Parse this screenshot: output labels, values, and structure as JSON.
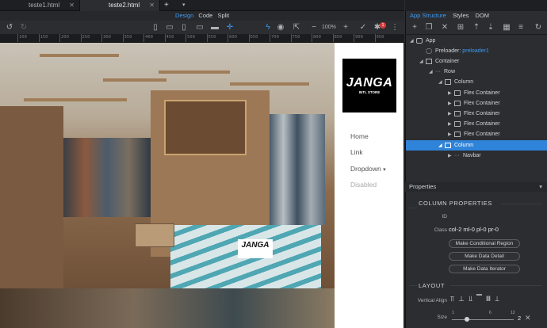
{
  "tabs": [
    {
      "label": "teste1.html"
    },
    {
      "label": "teste2.html"
    }
  ],
  "tab_close": "✕",
  "tab_add": "+",
  "modes": [
    "Design",
    "Code",
    "Split"
  ],
  "toolbar": {
    "zoom": "100%",
    "badge": "1"
  },
  "ruler": [
    "100",
    "150",
    "200",
    "250",
    "300",
    "350",
    "400",
    "450",
    "500",
    "550",
    "600",
    "650",
    "700",
    "750",
    "800",
    "850",
    "900",
    "950"
  ],
  "site": {
    "logo_main": "JANGA",
    "logo_sub": "INTL STORE",
    "nav": [
      "Home",
      "Link",
      "Dropdown",
      "Disabled"
    ],
    "dropdown_caret": "▾"
  },
  "panel": {
    "tabs": [
      "App Structure",
      "Styles",
      "DOM"
    ],
    "tree": [
      {
        "label": "App"
      },
      {
        "label": "Preloader:",
        "extra": "preloader1"
      },
      {
        "label": "Container"
      },
      {
        "label": "Row"
      },
      {
        "label": "Column"
      },
      {
        "label": "Flex Container"
      },
      {
        "label": "Flex Container"
      },
      {
        "label": "Flex Container"
      },
      {
        "label": "Flex Container"
      },
      {
        "label": "Flex Container"
      },
      {
        "label": "Column"
      },
      {
        "label": "Navbar"
      }
    ],
    "properties_header": "Properties",
    "section_title": "COLUMN PROPERTIES",
    "id_label": "ID",
    "class_label": "Class",
    "class_value": "col-2 ml-0 pl-0 pr-0",
    "buttons": [
      "Make Conditional Region",
      "Make Data Detail",
      "Make Data Iterator"
    ],
    "layout_title": "LAYOUT",
    "vertical_align_label": "Vertical Align",
    "size_label": "Size",
    "size_ticks": [
      "1",
      "6",
      "12"
    ],
    "size_value": "2"
  }
}
